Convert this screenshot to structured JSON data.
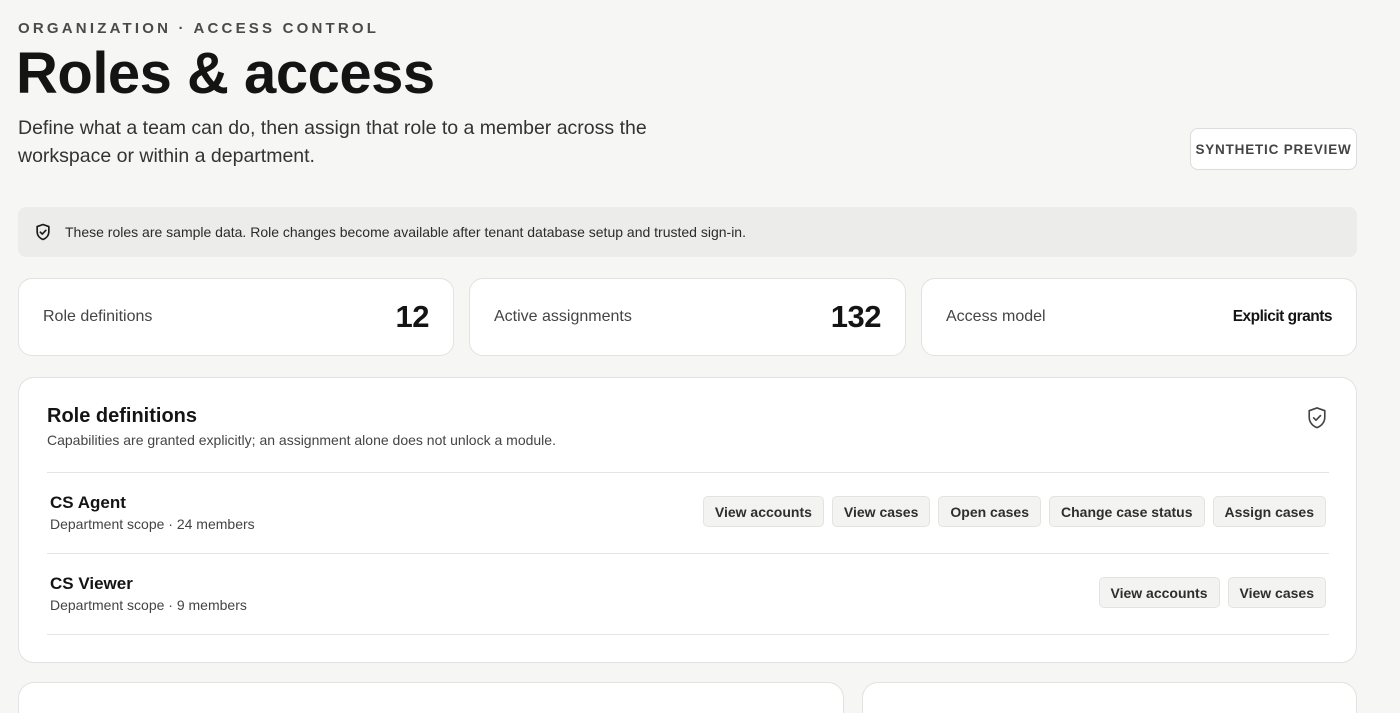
{
  "header": {
    "eyebrow": "ORGANIZATION · ACCESS CONTROL",
    "title": "Roles & access",
    "subtitle": "Define what a team can do, then assign that role to a member across the workspace or within a department.",
    "preview_button": "SYNTHETIC PREVIEW"
  },
  "notice": {
    "icon": "shield-check-icon",
    "text": "These roles are sample data. Role changes become available after tenant database setup and trusted sign-in."
  },
  "stats": [
    {
      "label": "Role definitions",
      "value": "12"
    },
    {
      "label": "Active assignments",
      "value": "132"
    },
    {
      "label": "Access model",
      "value": "Explicit grants"
    }
  ],
  "roles_panel": {
    "title": "Role definitions",
    "subtitle": "Capabilities are granted explicitly; an assignment alone does not unlock a module.",
    "icon": "shield-check-icon",
    "roles": [
      {
        "name": "CS Agent",
        "meta": "Department scope · 24 members",
        "capabilities": [
          "View accounts",
          "View cases",
          "Open cases",
          "Change case status",
          "Assign cases"
        ]
      },
      {
        "name": "CS Viewer",
        "meta": "Department scope · 9 members",
        "capabilities": [
          "View accounts",
          "View cases"
        ]
      }
    ]
  }
}
